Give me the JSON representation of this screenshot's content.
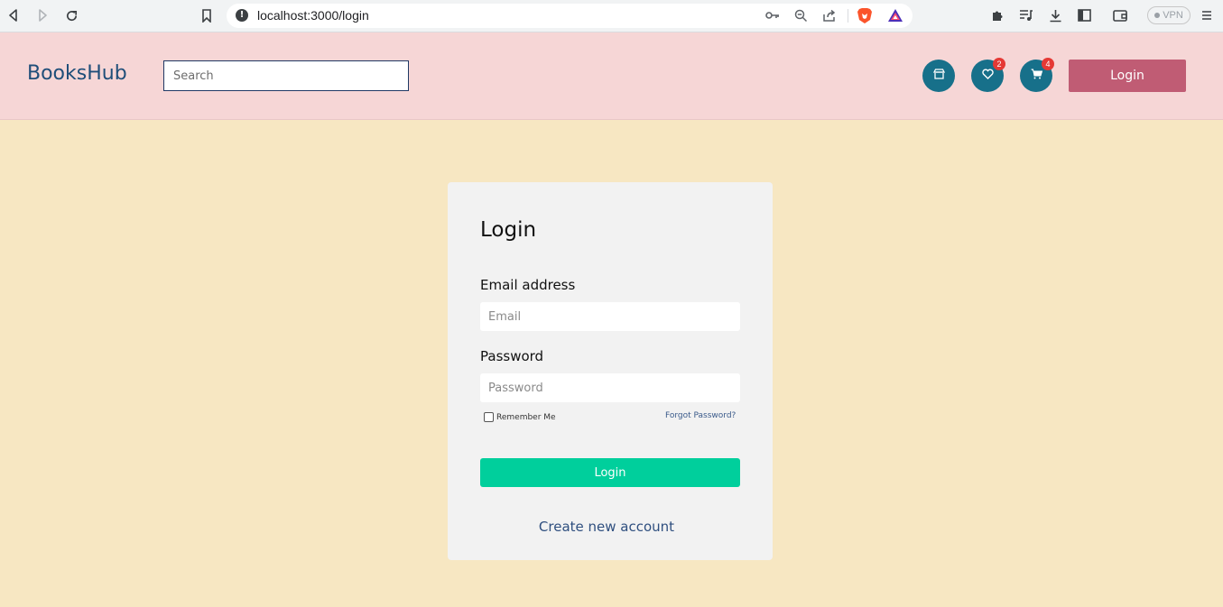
{
  "browser": {
    "url": "localhost:3000/login",
    "vpn_label": "VPN",
    "icons": [
      "back-icon",
      "forward-icon",
      "reload-icon",
      "bookmark-icon",
      "site-info-icon",
      "key-icon",
      "zoom-out-icon",
      "share-icon",
      "brave-shields-icon",
      "brave-rewards-icon",
      "extensions-icon",
      "playlist-icon",
      "download-icon",
      "sidebar-icon",
      "wallet-icon",
      "menu-icon"
    ]
  },
  "header": {
    "brand": "BooksHub",
    "search_placeholder": "Search",
    "wishlist_count": "2",
    "cart_count": "4",
    "login_label": "Login",
    "icons": [
      "store-icon",
      "heart-icon",
      "cart-icon"
    ],
    "colors": {
      "header_bg": "#f6d6d6",
      "icon_btn": "#17708a",
      "login_btn": "#c05c74",
      "badge": "#e53935"
    }
  },
  "login_form": {
    "title": "Login",
    "email_label": "Email address",
    "email_placeholder": "Email",
    "password_label": "Password",
    "password_placeholder": "Password",
    "remember_label": "Remember Me",
    "forgot_label": "Forgot Password?",
    "submit_label": "Login",
    "create_account_label": "Create new account",
    "colors": {
      "page_bg": "#f7e7c2",
      "card_bg": "#f2f2f2",
      "submit_btn": "#00cf9c"
    }
  }
}
